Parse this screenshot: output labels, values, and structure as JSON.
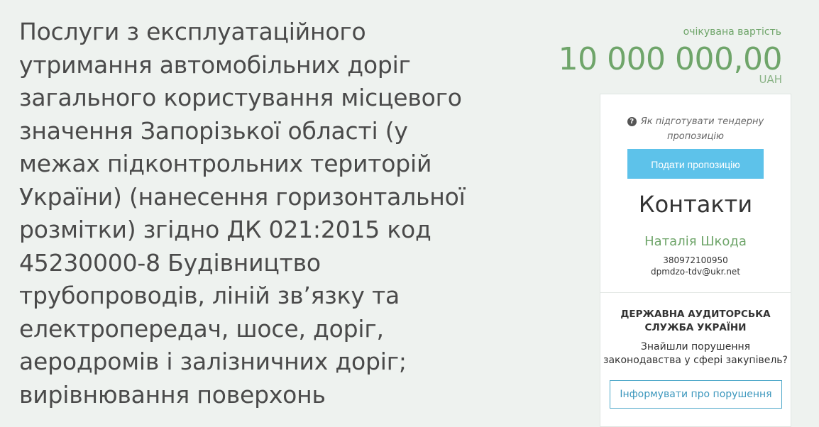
{
  "tender": {
    "title": "Послуги з експлуатаційного утримання автомобільних доріг загального користування місцевого значення Запорізької області (у межах підконтрольних територій України) (нанесення горизонтальної розмітки) згідно ДК 021:2015 код 45230000-8 Будівництво трубопроводів, ліній зв’язку та електропередач, шосе, доріг, аеродромів і залізничних доріг; вирівнювання поверхонь"
  },
  "price": {
    "label": "очікувана вартість",
    "value": "10 000 000,00",
    "currency": "UAH"
  },
  "sidebar": {
    "howto_icon": "question-circle-icon",
    "howto_line1": "Як підготувати тендерну",
    "howto_line2": "пропозицію",
    "submit_label": "Подати пропозицію",
    "contacts_title": "Контакти",
    "contact_name": "Наталія Шкода",
    "contact_phone": "380972100950",
    "contact_email": "dpmdzo-tdv@ukr.net",
    "audit_title_line1": "ДЕРЖАВНА АУДИТОРСЬКА",
    "audit_title_line2": "СЛУЖБА УКРАЇНИ",
    "audit_text_line1": "Знайшли порушення",
    "audit_text_line2": "законодавства у сфері закупівель?",
    "report_label": "Інформувати про порушення"
  },
  "colors": {
    "background": "#eef2ef",
    "accent_green": "#6fa56a",
    "submit_button": "#5dc2ea",
    "report_border": "#4aa6c8"
  }
}
